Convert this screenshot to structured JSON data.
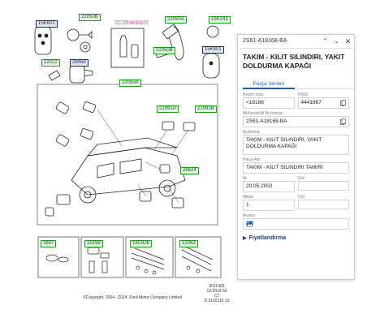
{
  "diagram": {
    "callouts": [
      {
        "key": "c1",
        "text": "15K601",
        "style": "navy"
      },
      {
        "key": "c2",
        "text": "22050B",
        "style": "green"
      },
      {
        "key": "c3",
        "text": "22050A",
        "style": "green"
      },
      {
        "key": "c4",
        "text": "15K243",
        "style": "green"
      },
      {
        "key": "c5",
        "text": "15K601",
        "style": "navy"
      },
      {
        "key": "c6",
        "text": "22022",
        "style": "green"
      },
      {
        "key": "c7",
        "text": "28468",
        "style": "navy"
      },
      {
        "key": "c8",
        "text": "22050B",
        "style": "green"
      },
      {
        "key": "c9",
        "text": "22050A",
        "style": "green"
      },
      {
        "key": "c10",
        "text": "21991A",
        "style": "green"
      },
      {
        "key": "c11",
        "text": "21991B",
        "style": "green"
      },
      {
        "key": "c12",
        "text": "28624",
        "style": "green"
      },
      {
        "key": "c13",
        "text": "3697",
        "style": "green"
      },
      {
        "key": "c14",
        "text": "15199",
        "style": "green"
      },
      {
        "key": "c15",
        "text": "16C826",
        "style": "green"
      },
      {
        "key": "c16",
        "text": "22063",
        "style": "green"
      }
    ],
    "part_note": "7C7ZFA030107",
    "ref_code": "5011405\n12.2014 50\nC7\nD 0102116 13",
    "copyright": "©Copyright, 2004 - 2014, Ford Motor Company Limited"
  },
  "panel": {
    "header_title": "2S61-A18168-BA",
    "title": "TAKIM - KILIT SILINDIRI, YAKIT DOLDURMA KAPAĞI",
    "tab": "Parça Verileri",
    "fields": {
      "resim_notu_label": "Resim notu",
      "resim_notu_value": "<18168",
      "finis_label": "FINIS",
      "finis_value": "4441867",
      "muhendislik_label": "Mühendislik Numarası",
      "muhendislik_value": "2S61-A18168-BA",
      "aciklama_label": "Açıklama",
      "aciklama_value": "TAKIM - KILIT SILINDIRI, YAKIT DOLDURMA KAPAĞI",
      "parca_adi_label": "Parça Adı",
      "parca_adi_value": "TAKIM - KILIT SILINDIRI TAMIRI",
      "ilk_label": "İlk",
      "ilk_value": "20.05.2002",
      "son_label": "Son",
      "son_value": "",
      "miktar_label": "Miktar",
      "miktar_value": "1",
      "osi_label": "OSI",
      "osi_value": "",
      "arama_label": "Arama"
    },
    "pricing_section": "Fiyatlandırma"
  },
  "colors": {
    "accent": "#1e5fa8",
    "callout_green": "#18a318",
    "callout_navy": "#1b2b7a",
    "part_note": "#d0208a"
  },
  "icons": {
    "prev": "chevron-up-icon",
    "next": "chevron-down-icon",
    "close": "close-icon",
    "copy": "copy-icon",
    "image": "image-icon",
    "expand": "triangle-right-icon"
  }
}
